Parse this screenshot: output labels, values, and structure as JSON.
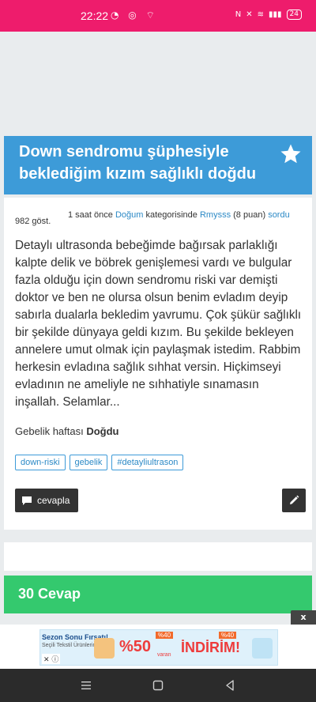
{
  "status": {
    "time": "22:22",
    "battery": "24"
  },
  "question": {
    "title": "Down sendromu şüphesiyle beklediğim kızım sağlıklı doğdu",
    "views": "982 göst.",
    "time_ago": "1 saat önce",
    "category": "Doğum",
    "category_suffix": "kategorisinde",
    "author": "Rmysss",
    "points": "(8 puan)",
    "action": "sordu",
    "body": "Detaylı ultrasonda bebeğimde bağırsak parlaklığı kalpte delik ve böbrek genişlemesi vardı ve bulgular fazla olduğu için down sendromu riski var demişti doktor ve ben ne olursa olsun benim evladım deyip sabırla dualarla bekledim yavrumu. Çok şükür sağlıklı bir şekilde dünyaya geldi kızım. Bu şekilde bekleyen annelere umut olmak için paylaşmak istedim. Rabbim herkesin evladına sağlık sıhhat versin. Hiçkimseyi evladının ne ameliyle ne sıhhatiyle sınamasın inşallah. Selamlar...",
    "week_label": "Gebelik haftası",
    "week_value": "Doğdu",
    "tags": [
      "down-riski",
      "gebelik",
      "#detayliultrason"
    ],
    "reply_label": "cevapla"
  },
  "answers": {
    "label": "30 Cevap"
  },
  "ad": {
    "headline": "Sezon Sonu Fırsatı!",
    "subline": "Seçili Tekstil Ürünlerinde",
    "percent": "%50",
    "varan": "varan",
    "badge": "%40",
    "indirim": "İNDİRİM!",
    "close": "x"
  },
  "colors": {
    "title_bg": "#3d9bd8",
    "answers_bg": "#34c96e",
    "status_bg": "#ee1c6c",
    "link": "#2d8ac6"
  },
  "icons": [
    "star-icon",
    "comment-icon",
    "pencil-icon",
    "menu-icon",
    "home-icon",
    "back-icon"
  ]
}
